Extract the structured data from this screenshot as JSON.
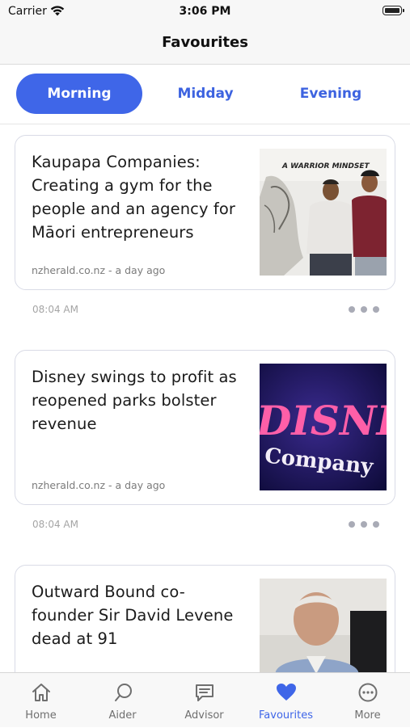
{
  "status_bar": {
    "carrier": "Carrier",
    "time": "3:06 PM"
  },
  "nav": {
    "title": "Favourites"
  },
  "segments": [
    {
      "label": "Morning",
      "active": true
    },
    {
      "label": "Midday",
      "active": false
    },
    {
      "label": "Evening",
      "active": false
    }
  ],
  "articles": [
    {
      "headline": "Kaupapa Companies: Creating a gym for the people and an agency for Māori entrepreneurs",
      "source": "nzherald.co.nz - a day ago",
      "time": "08:04 AM",
      "image_text": "A WARRIOR MINDSET"
    },
    {
      "headline": "Disney swings to profit as reopened parks bolster revenue",
      "source": "nzherald.co.nz - a day ago",
      "time": "08:04 AM",
      "image_text_1": "DISNEY",
      "image_text_2": "Company"
    },
    {
      "headline": "Outward Bound co-founder Sir David Levene dead at 91"
    }
  ],
  "tabs": [
    {
      "label": "Home",
      "icon": "home-icon",
      "active": false
    },
    {
      "label": "Aider",
      "icon": "chat-bubble-icon",
      "active": false
    },
    {
      "label": "Advisor",
      "icon": "message-icon",
      "active": false
    },
    {
      "label": "Favourites",
      "icon": "heart-icon",
      "active": true
    },
    {
      "label": "More",
      "icon": "more-icon",
      "active": false
    }
  ],
  "colors": {
    "accent": "#3f66e8",
    "card_border": "#d9dbe6",
    "muted_text": "#7b7b7b",
    "bar_background": "#f7f7f7"
  }
}
